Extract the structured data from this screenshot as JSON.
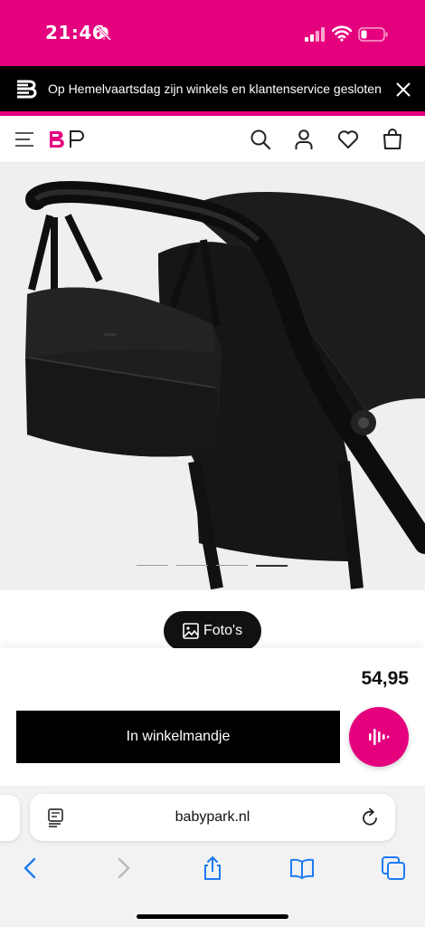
{
  "status_bar": {
    "time": "21:46"
  },
  "announcement": {
    "text": "Op Hemelvaartsdag zijn winkels en klantenservice gesloten"
  },
  "header": {
    "brand_accent": "#e5007e"
  },
  "carousel": {
    "slides": 4,
    "active_index": 3
  },
  "gallery": {
    "photos_label": "Foto's"
  },
  "product": {
    "price": "54,95",
    "add_to_cart_label": "In winkelmandje"
  },
  "browser": {
    "url": "babypark.nl"
  },
  "colors": {
    "brand_pink": "#e5007e",
    "black": "#000000"
  },
  "icons": [
    "bell-slash-icon",
    "signal-icon",
    "wifi-icon",
    "battery-icon",
    "close-icon",
    "menu-icon",
    "search-icon",
    "account-icon",
    "heart-icon",
    "cart-icon",
    "image-icon",
    "voice-icon",
    "reader-icon",
    "reload-icon",
    "back-icon",
    "forward-icon",
    "share-icon",
    "bookmarks-icon",
    "tabs-icon"
  ]
}
